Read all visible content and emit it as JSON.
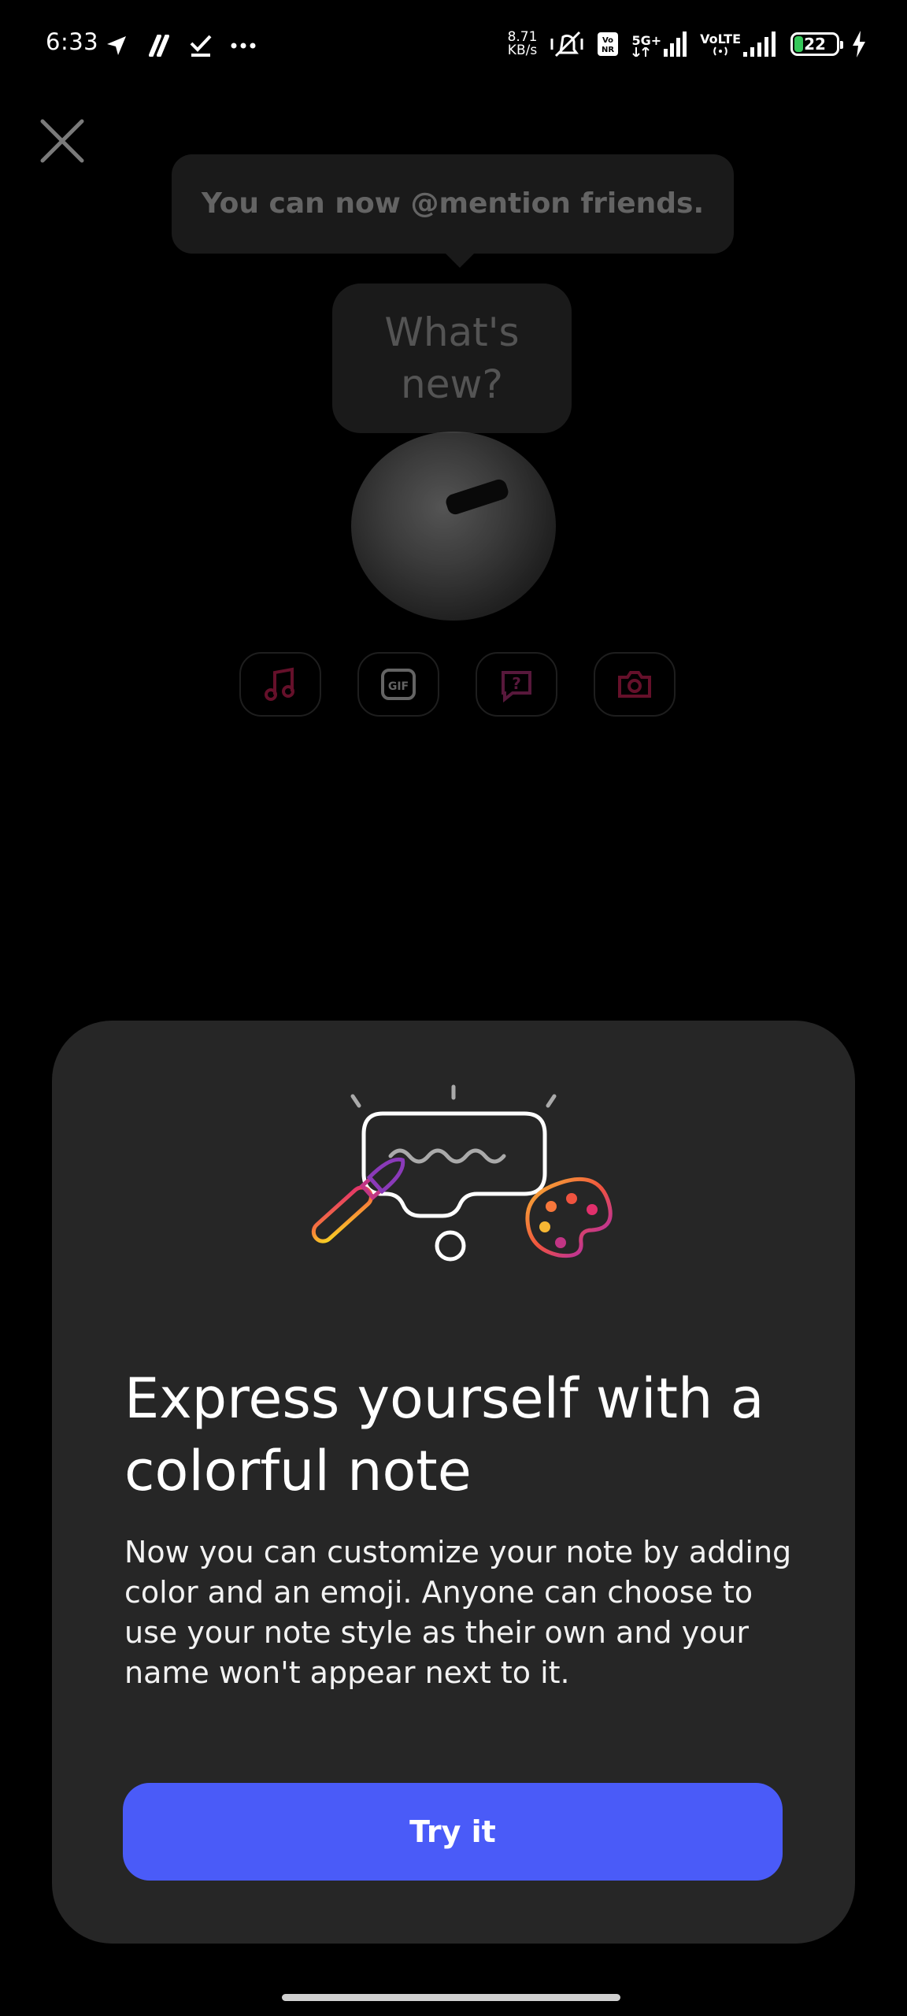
{
  "status_bar": {
    "time": "6:33",
    "net_speed_value": "8.71",
    "net_speed_unit": "KB/s",
    "network_1": "5G+",
    "network_2": "VoLTE",
    "battery_level": "22",
    "battery_fraction": 0.22,
    "battery_color": "#34c759",
    "icons": [
      "navigation-icon",
      "app-notification-icon",
      "checkmark-icon",
      "more-icon",
      "mute-icon",
      "vonr-icon",
      "signal-icon",
      "charging-icon"
    ]
  },
  "editor": {
    "tooltip": "You can now @mention friends.",
    "note_placeholder": "What's new?",
    "tools": [
      "music-icon",
      "gif-icon",
      "question-icon",
      "camera-icon"
    ]
  },
  "sheet": {
    "title": "Express yourself with a colorful note",
    "body": "Now you can customize your note by adding color and an emoji. Anyone can choose to use your note style as their own and your name won't appear next to it.",
    "button_label": "Try it",
    "button_color": "#4a5bf8",
    "background": "#262626"
  }
}
